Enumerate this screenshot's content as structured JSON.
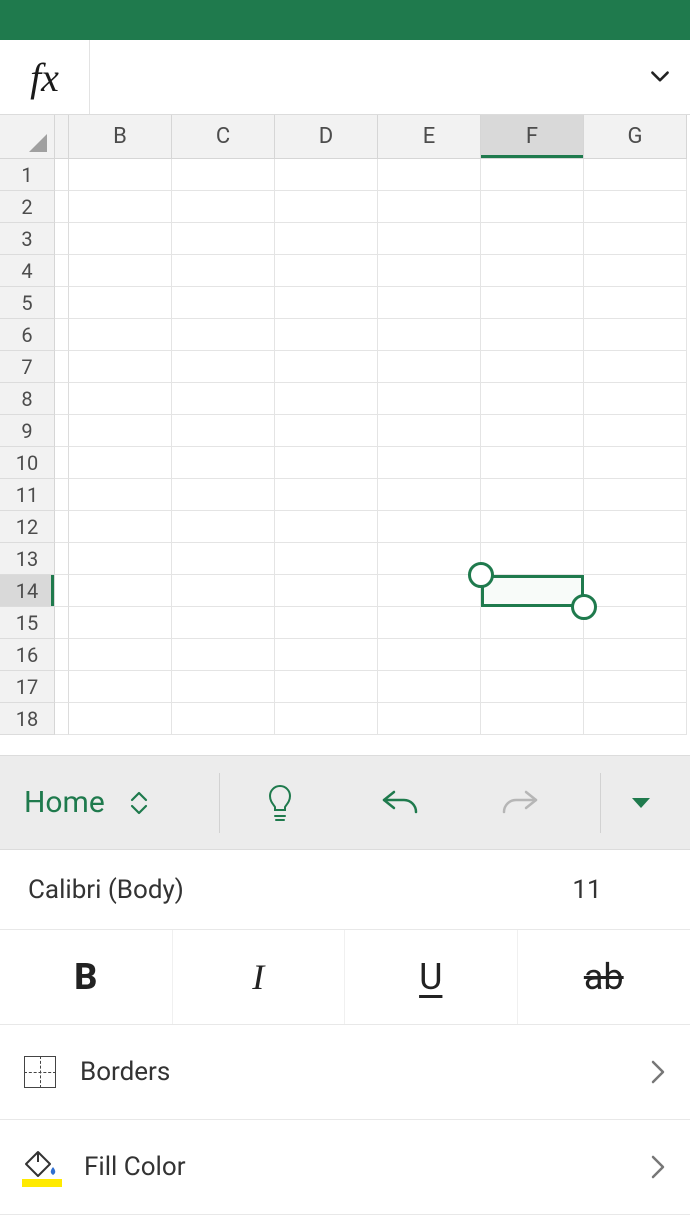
{
  "app": {
    "brand_color": "#1f7a4d"
  },
  "formula_bar": {
    "fx_label": "fx",
    "value": ""
  },
  "sheet": {
    "columns": [
      "B",
      "C",
      "D",
      "E",
      "F",
      "G"
    ],
    "active_column": "F",
    "rows": [
      "1",
      "2",
      "3",
      "4",
      "5",
      "6",
      "7",
      "8",
      "9",
      "10",
      "11",
      "12",
      "13",
      "14",
      "15",
      "16",
      "17",
      "18"
    ],
    "active_row": "14",
    "selected_cell": "F14"
  },
  "ribbon": {
    "tab_label": "Home"
  },
  "format_panel": {
    "font_name": "Calibri (Body)",
    "font_size": "11",
    "bold_label": "B",
    "italic_label": "I",
    "underline_label": "U",
    "strike_label": "ab",
    "rows": {
      "borders": "Borders",
      "fill_color": "Fill Color"
    }
  }
}
